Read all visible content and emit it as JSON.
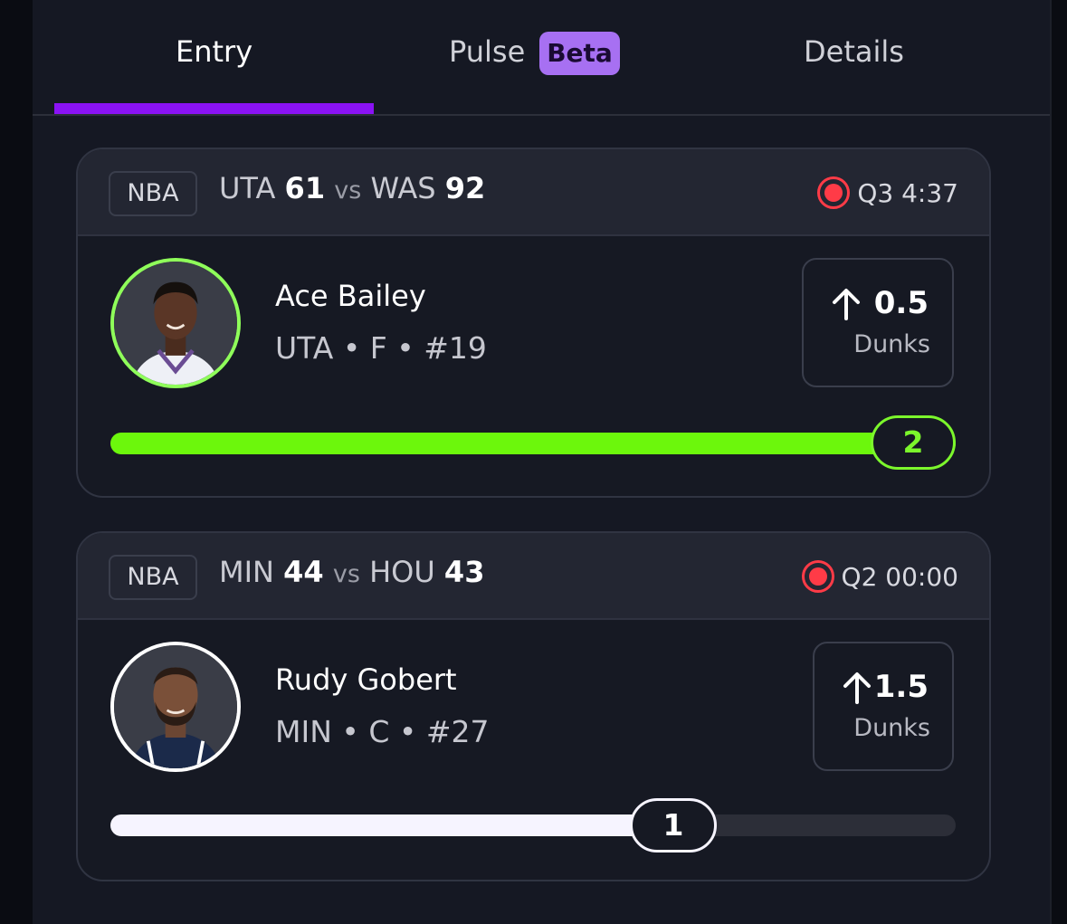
{
  "tabs": {
    "entry": "Entry",
    "pulse": "Pulse",
    "pulse_badge": "Beta",
    "details": "Details",
    "active": "Entry"
  },
  "colors": {
    "accent": "#8a12f4",
    "badge": "#a770f2",
    "hit_green": "#6cf70c",
    "live_red": "#ff3b47"
  },
  "picks": [
    {
      "league": "NBA",
      "away_team": "UTA",
      "away_score": "61",
      "vs": "vs",
      "home_team": "WAS",
      "home_score": "92",
      "game_clock": "Q3 4:37",
      "live_icon": "live-indicator-icon",
      "player_name": "Ace Bailey",
      "player_meta": "UTA • F • #19",
      "direction_icon": "arrow-up-icon",
      "line": "0.5",
      "stat": "Dunks",
      "current_value": "2",
      "progress_fraction": 1.0,
      "status_color": "green"
    },
    {
      "league": "NBA",
      "away_team": "MIN",
      "away_score": "44",
      "vs": "vs",
      "home_team": "HOU",
      "home_score": "43",
      "game_clock": "Q2 00:00",
      "live_icon": "live-indicator-icon",
      "player_name": "Rudy Gobert",
      "player_meta": "MIN • C • #27",
      "direction_icon": "arrow-up-icon",
      "line": "1.5",
      "stat": "Dunks",
      "current_value": "1",
      "progress_fraction": 0.667,
      "status_color": "white"
    }
  ]
}
